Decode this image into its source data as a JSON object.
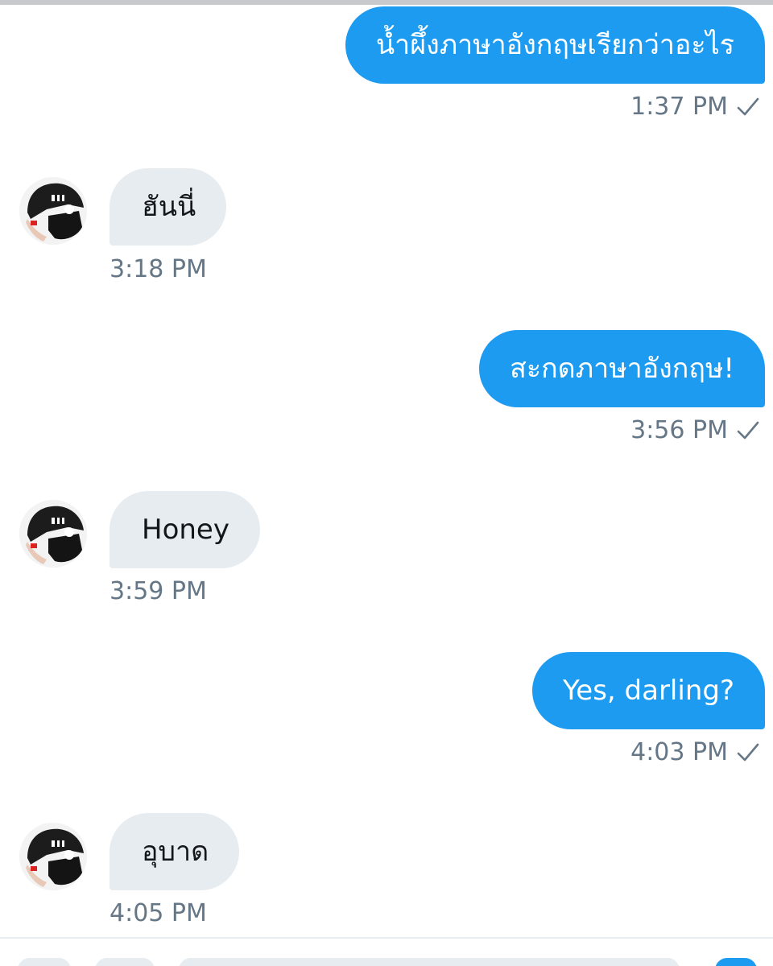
{
  "colors": {
    "outgoing_bubble": "#1d9bf0",
    "incoming_bubble": "#e6ecf0",
    "meta_text": "#657786"
  },
  "messages": [
    {
      "direction": "out",
      "text": "น้ำผึ้งภาษาอังกฤษเรียกว่าอะไร",
      "time": "1:37 PM",
      "status_icon": "check-icon"
    },
    {
      "direction": "in",
      "text": "ฮันนี่",
      "time": "3:18 PM",
      "avatar_icon": "avatar"
    },
    {
      "direction": "out",
      "text": "สะกดภาษาอังกฤษ!",
      "time": "3:56 PM",
      "status_icon": "check-icon"
    },
    {
      "direction": "in",
      "text": "Honey",
      "time": "3:59 PM",
      "avatar_icon": "avatar"
    },
    {
      "direction": "out",
      "text": "Yes, darling?",
      "time": "4:03 PM",
      "status_icon": "check-icon"
    },
    {
      "direction": "in",
      "text": "อุบาด",
      "time": "4:05 PM",
      "avatar_icon": "avatar"
    }
  ]
}
